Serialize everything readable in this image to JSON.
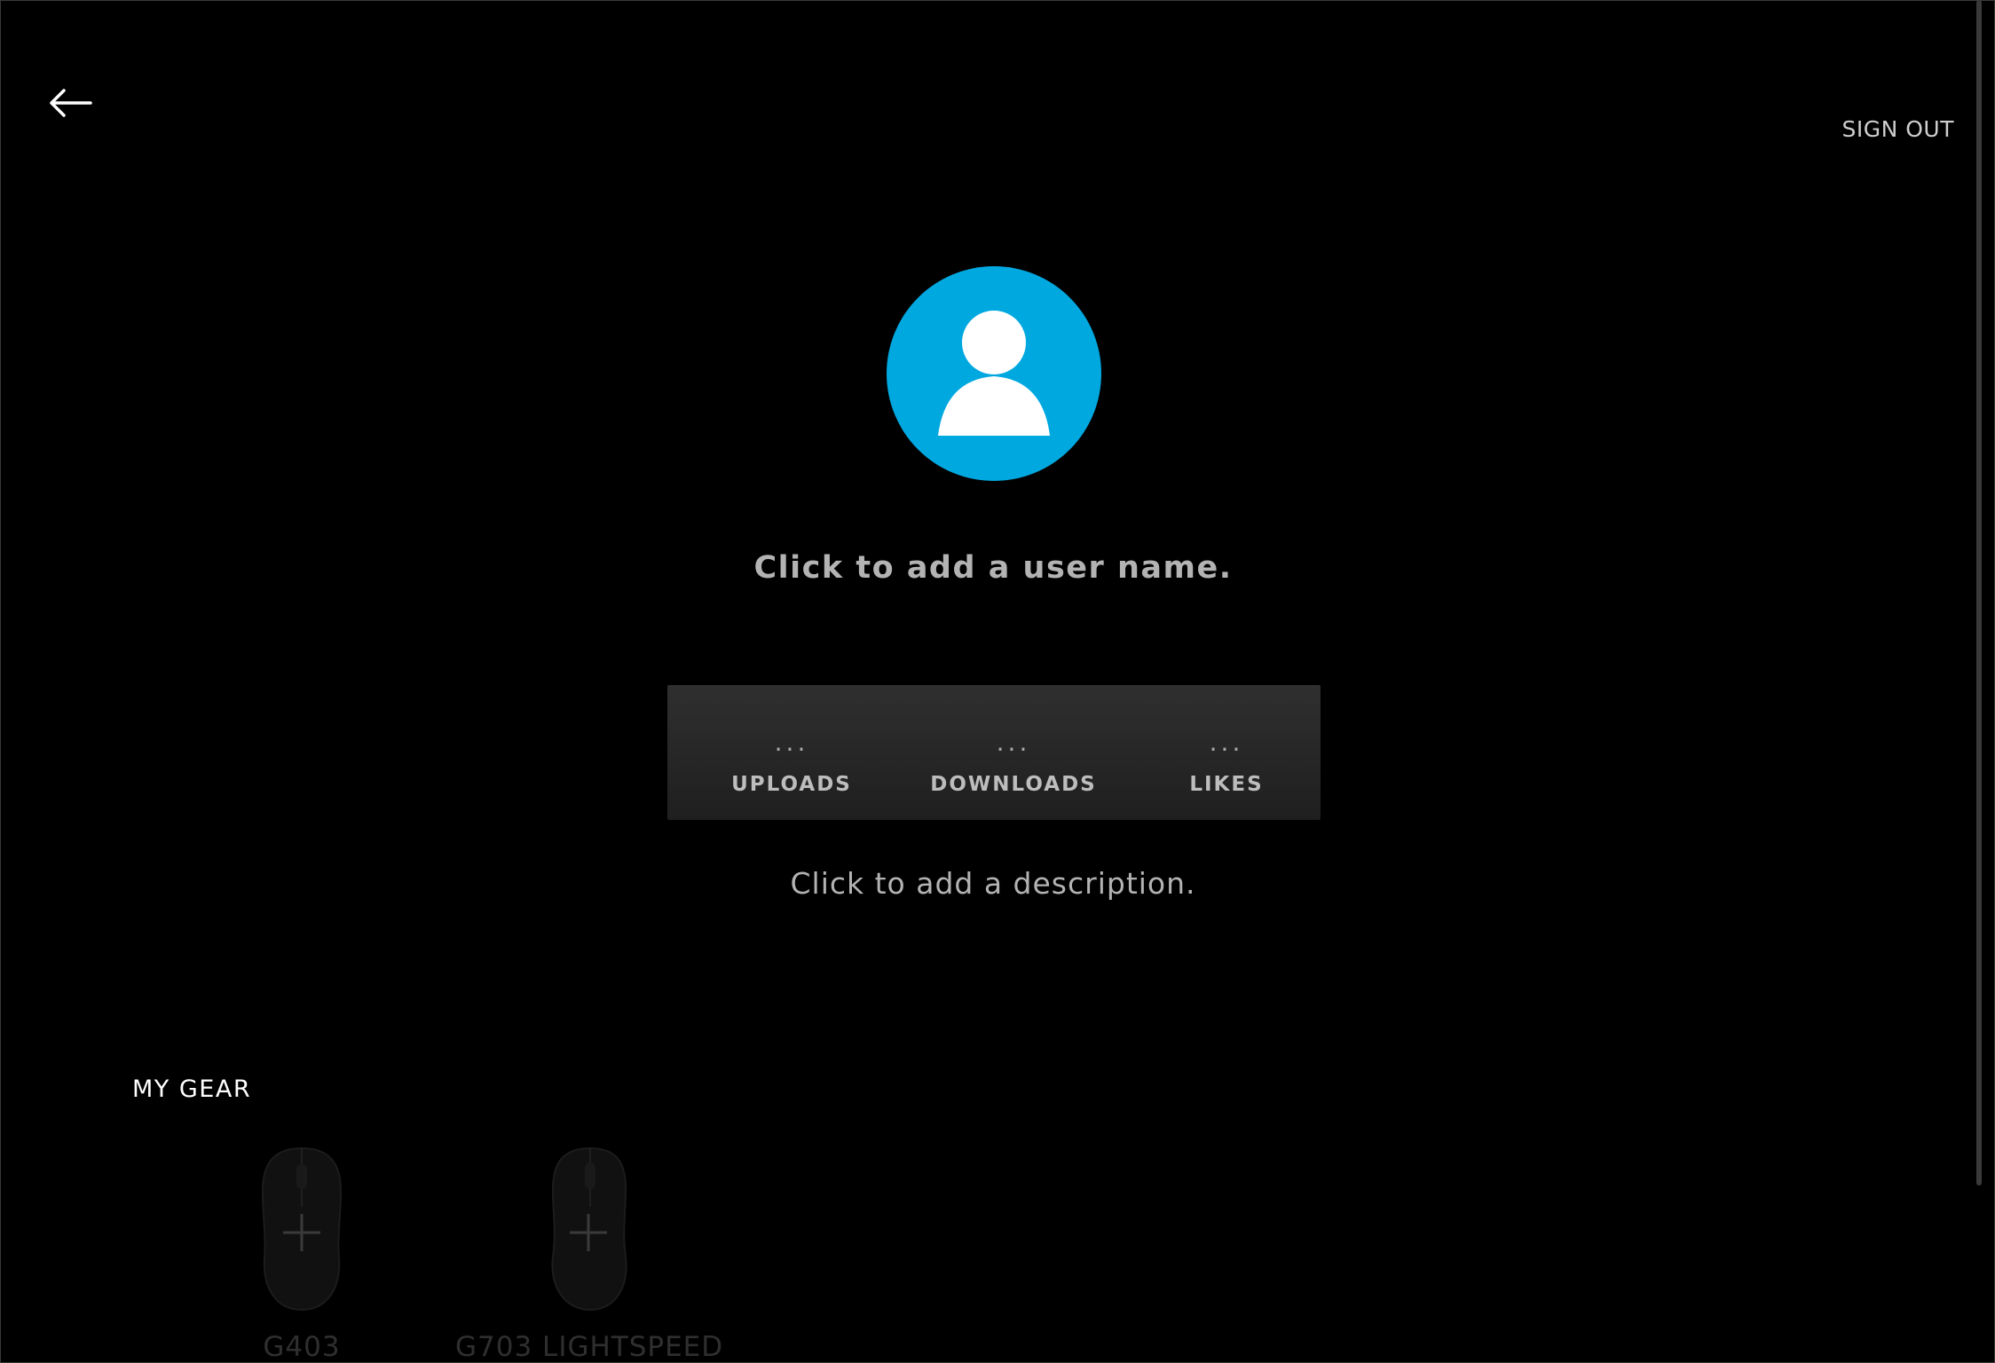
{
  "header": {
    "back_icon": "arrow-left-icon",
    "sign_out_label": "SIGN OUT"
  },
  "profile": {
    "avatar_icon": "user-silhouette-icon",
    "avatar_color": "#00A8E0",
    "username_placeholder": "Click to add a user name.",
    "description_placeholder": "Click to add a description."
  },
  "stats": [
    {
      "value": "...",
      "label": "UPLOADS"
    },
    {
      "value": "...",
      "label": "DOWNLOADS"
    },
    {
      "value": "...",
      "label": "LIKES"
    }
  ],
  "gear": {
    "heading": "MY GEAR",
    "items": [
      {
        "name": "G403",
        "icon": "mouse-icon",
        "action_icon": "plus-icon"
      },
      {
        "name": "G703 LIGHTSPEED",
        "icon": "mouse-icon",
        "action_icon": "plus-icon"
      }
    ]
  }
}
